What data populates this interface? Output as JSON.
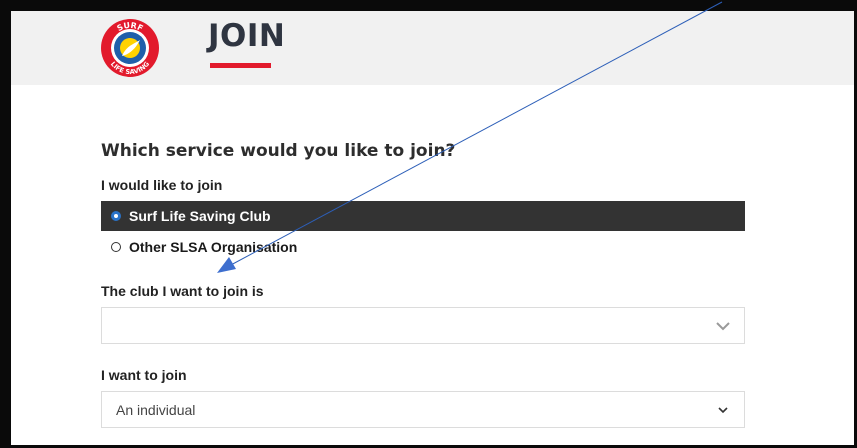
{
  "header": {
    "logo_text_top": "SURF",
    "logo_text_bottom": "LIFE SAVING",
    "title": "JOIN",
    "accent_color": "#e21a2c"
  },
  "form": {
    "question": "Which service would you like to join?",
    "join_label": "I would like to join",
    "options": [
      {
        "label": "Surf Life Saving Club",
        "selected": true
      },
      {
        "label": "Other SLSA Organisation",
        "selected": false
      }
    ],
    "club_label": "The club I want to join is",
    "club_value": "",
    "want_label": "I want to join",
    "want_value": "An individual"
  }
}
